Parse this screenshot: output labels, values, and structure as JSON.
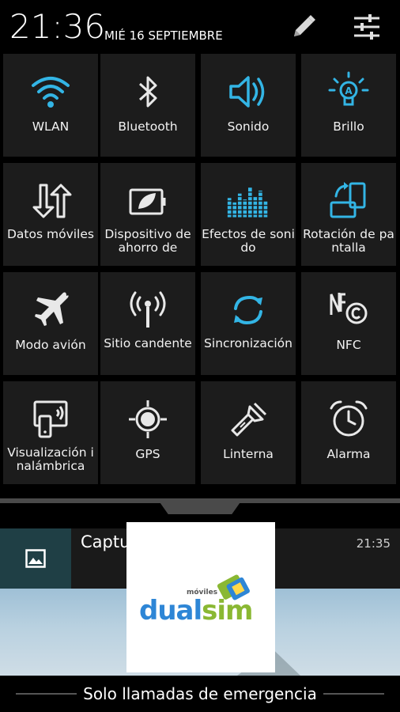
{
  "status": {
    "time": "21:36",
    "date": "MIÉ 16 SEPTIEMBRE"
  },
  "header_icons": {
    "edit": "pencil-icon",
    "settings": "sliders-icon"
  },
  "tiles": [
    {
      "label": "WLAN",
      "icon": "wifi-icon",
      "active": true
    },
    {
      "label": "Bluetooth",
      "icon": "bluetooth-icon",
      "active": false
    },
    {
      "label": "Sonido",
      "icon": "speaker-icon",
      "active": true
    },
    {
      "label": "Brillo",
      "icon": "brightness-bulb-icon",
      "active": true
    },
    {
      "label": "Datos móviles",
      "icon": "mobile-data-icon",
      "active": false
    },
    {
      "label": "Dispositivo de ahorro de",
      "icon": "power-saving-icon",
      "active": false
    },
    {
      "label": "Efectos de sonido",
      "icon": "equalizer-icon",
      "active": true
    },
    {
      "label": "Rotación de pantalla",
      "icon": "screen-rotation-icon",
      "active": true
    },
    {
      "label": "Modo avión",
      "icon": "airplane-icon",
      "active": false
    },
    {
      "label": "Sitio candente",
      "icon": "hotspot-icon",
      "active": false
    },
    {
      "label": "Sincronización",
      "icon": "sync-icon",
      "active": true
    },
    {
      "label": "NFC",
      "icon": "nfc-icon",
      "active": false
    },
    {
      "label": "Visualización inalámbrica",
      "icon": "wireless-display-icon",
      "active": false
    },
    {
      "label": "GPS",
      "icon": "gps-icon",
      "active": false
    },
    {
      "label": "Linterna",
      "icon": "flashlight-icon",
      "active": false
    },
    {
      "label": "Alarma",
      "icon": "alarm-clock-icon",
      "active": false
    }
  ],
  "notification": {
    "title": "Captura guardada",
    "time": "21:35",
    "icon": "image-icon"
  },
  "watermark": {
    "small": "móviles",
    "part1": "dual",
    "part2": "sim"
  },
  "footer": {
    "text": "Solo llamadas de emergencia"
  },
  "colors": {
    "accent": "#33b5e5",
    "tile_bg": "#1c1c1c",
    "notif_icon_bg": "#1f3f45"
  }
}
